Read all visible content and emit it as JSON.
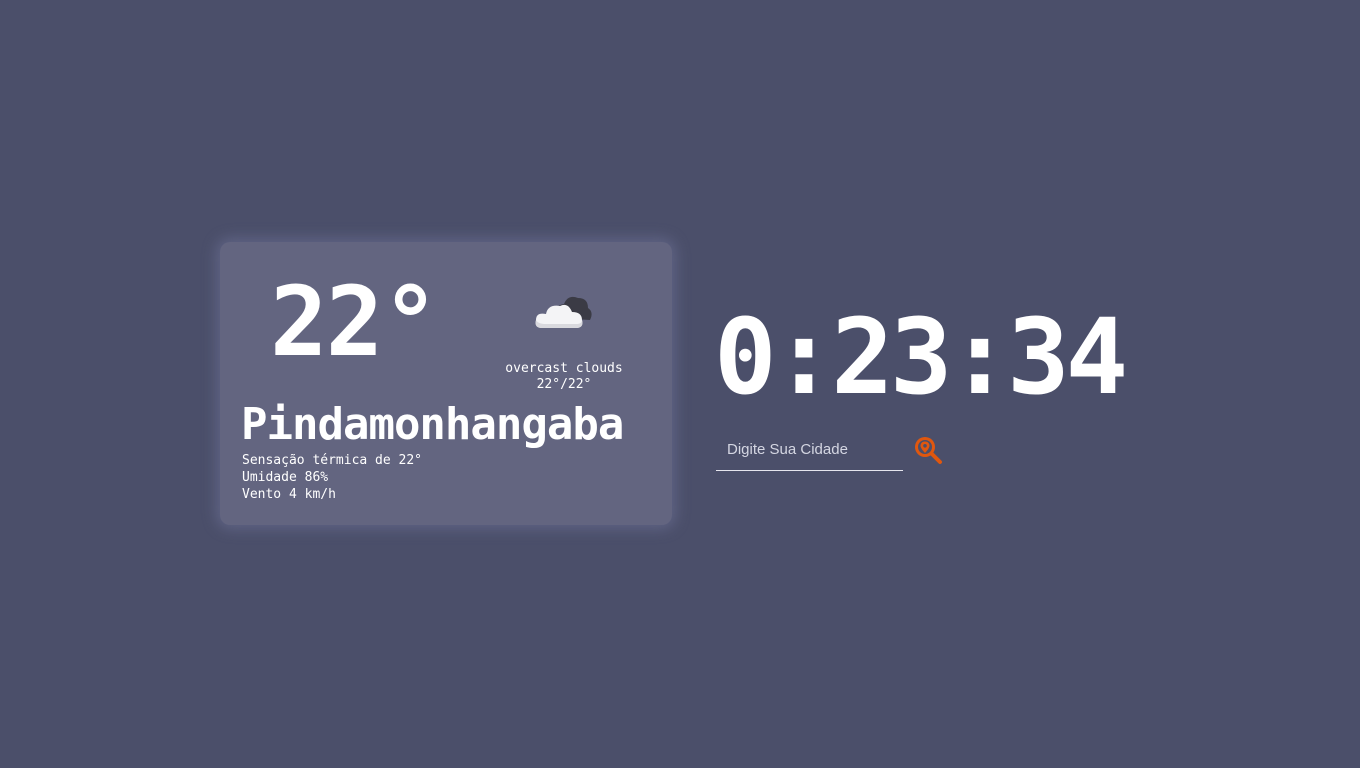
{
  "weather": {
    "temperature": "22°",
    "icon": "overcast-clouds-icon",
    "description": "overcast clouds",
    "min_max": "22°/22°",
    "city": "Pindamonhangaba",
    "feels_like": "Sensação térmica de 22°",
    "humidity": "Umidade 86%",
    "wind": "Vento 4 km/h"
  },
  "clock": {
    "time": "0:23:34"
  },
  "search": {
    "placeholder": "Digite Sua Cidade",
    "value": "",
    "button_icon": "location-search-icon"
  },
  "colors": {
    "background": "#4b4f6a",
    "card": "#636580",
    "text": "#ffffff",
    "accent": "#e0570e"
  }
}
